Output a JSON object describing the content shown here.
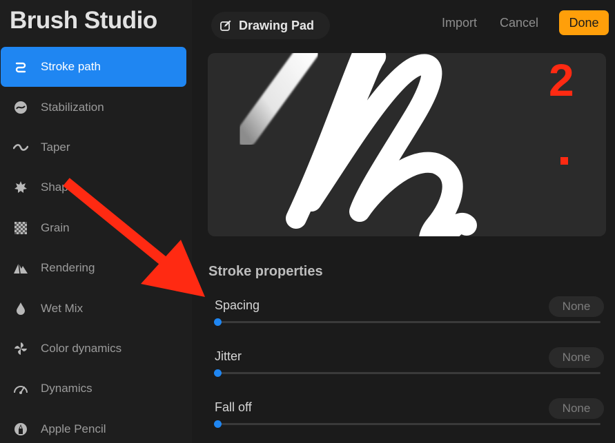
{
  "app_title": "Brush Studio",
  "sidebar": {
    "items": [
      {
        "label": "Stroke path",
        "icon": "stroke-path-icon",
        "active": true
      },
      {
        "label": "Stabilization",
        "icon": "stabilization-icon"
      },
      {
        "label": "Taper",
        "icon": "taper-icon"
      },
      {
        "label": "Shape",
        "icon": "shape-icon"
      },
      {
        "label": "Grain",
        "icon": "grain-icon"
      },
      {
        "label": "Rendering",
        "icon": "rendering-icon"
      },
      {
        "label": "Wet Mix",
        "icon": "wet-mix-icon"
      },
      {
        "label": "Color dynamics",
        "icon": "color-dynamics-icon"
      },
      {
        "label": "Dynamics",
        "icon": "dynamics-icon"
      },
      {
        "label": "Apple Pencil",
        "icon": "apple-pencil-icon"
      }
    ]
  },
  "header": {
    "drawing_pad": "Drawing Pad",
    "import": "Import",
    "cancel": "Cancel",
    "done": "Done"
  },
  "annotation": {
    "number": "2",
    "color": "#ff2a12"
  },
  "section_title": "Stroke properties",
  "properties": [
    {
      "label": "Spacing",
      "value": "None",
      "level": 0
    },
    {
      "label": "Jitter",
      "value": "None",
      "level": 0
    },
    {
      "label": "Fall off",
      "value": "None",
      "level": 0
    }
  ],
  "colors": {
    "accent": "#1f86f2",
    "done": "#ff9f0a",
    "annotation": "#ff2a12"
  }
}
